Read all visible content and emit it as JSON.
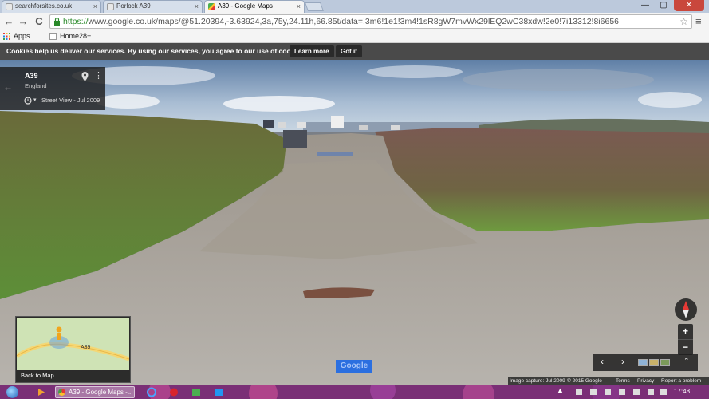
{
  "tabs": [
    {
      "label": "searchforsites.co.uk",
      "icon": "page-icon",
      "active": false
    },
    {
      "label": "Porlock A39",
      "icon": "page-icon",
      "active": false
    },
    {
      "label": "A39 - Google Maps",
      "icon": "google-maps-icon",
      "active": true
    }
  ],
  "tab_close": "×",
  "window": {
    "minimize": "—",
    "maximize": "▢",
    "close": "✕"
  },
  "toolbar": {
    "back": "←",
    "forward": "→",
    "reload": "C",
    "url_scheme": "https://",
    "url_rest": "www.google.co.uk/maps/@51.20394,-3.63924,3a,75y,24.11h,66.85t/data=!3m6!1e1!3m4!1sR8gW7mvWx29lEQ2wC38xdw!2e0!7i13312!8i6656",
    "star": "☆",
    "menu": "≡"
  },
  "bookmarks": [
    {
      "label": "Apps",
      "icon": "apps-icon"
    },
    {
      "label": "Home28+",
      "icon": "page-icon"
    }
  ],
  "cookie": {
    "text": "Cookies help us deliver our services. By using our services, you agree to our use of cookies.",
    "learn_more": "Learn more",
    "got_it": "Got it"
  },
  "place": {
    "back": "←",
    "name": "A39",
    "region": "England",
    "more": "⋮",
    "caret": "▾",
    "date": "Street View - Jul 2009"
  },
  "minimap": {
    "road_label": "A39",
    "back_to_map": "Back to Map"
  },
  "zoom": {
    "in": "+",
    "out": "−"
  },
  "filmstrip": {
    "prev": "‹",
    "next": "›",
    "expand": "⌃"
  },
  "google_logo": "Google",
  "footer": {
    "capture": "Image capture: Jul 2009",
    "copyright": "© 2015 Google",
    "terms": "Terms",
    "privacy": "Privacy",
    "report": "Report a problem"
  },
  "taskbar": {
    "active_task": "A39 - Google Maps -...",
    "tray_arrow": "▲",
    "clock": "17:48"
  },
  "colors": {
    "banner": "#4a4a4a",
    "https_green": "#2a8a2a",
    "taskbar": "#6b2a6b"
  }
}
